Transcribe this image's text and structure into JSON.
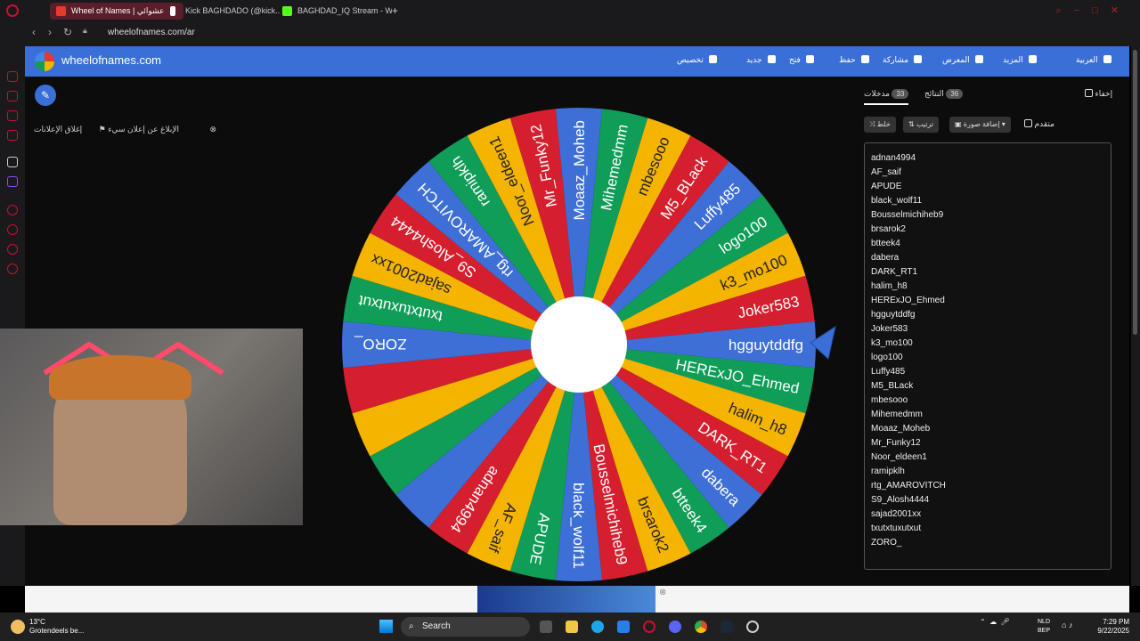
{
  "browser": {
    "tabs": [
      {
        "title": "Wheel of Names | عشوائي",
        "color": "#e63a2e"
      },
      {
        "title": "Kick BAGHDADO (@kick...",
        "color": "#ffffff"
      },
      {
        "title": "BAGHDAD_IQ Stream - W",
        "color": "#53fc18"
      }
    ],
    "url": "wheelofnames.com/ar"
  },
  "site": {
    "name": "wheelofnames.com",
    "menu": [
      "تخصيص",
      "جديد",
      "فتح",
      "حفظ",
      "مشاركة",
      "المعرض",
      "المزيد",
      "العربية"
    ],
    "report_ad": "الإبلاغ عن إعلان سيء",
    "close_ads": "إغلاق الإعلانات"
  },
  "wheel": {
    "entries": [
      "hgguytddfg",
      "HERExJO_Ehmed",
      "halim_h8",
      "DARK_RT1",
      "dabera",
      "btteek4",
      "brsarok2",
      "Bousselmichiheb9",
      "black_wolf11",
      "APUDE",
      "AF_saif",
      "adnan4994",
      "",
      "",
      "",
      "",
      "ZORO_",
      "txutxtuxutxut",
      "sajad2001xx",
      "S9_Alosh4444",
      "rtg_AMAROVITCH",
      "ramipklh",
      "Noor_eldeen1",
      "Mr_Funky12",
      "Moaaz_Moheb",
      "Mihemedmm",
      "mbesooo",
      "M5_BLack",
      "Luffy485",
      "logo100",
      "k3_mo100",
      "Joker583"
    ],
    "colors": [
      "#3d6fd6",
      "#0f9d58",
      "#f4b400",
      "#d51f2e"
    ]
  },
  "panel": {
    "tab_entries": "مدخلات",
    "tab_entries_count": "33",
    "tab_results": "النتائج",
    "tab_results_count": "36",
    "hide": "إخفاء",
    "shuffle": "خلط",
    "sort": "ترتيب",
    "add_image": "إضافة صورة",
    "advanced": "متقدم",
    "entries": [
      "adnan4994",
      "AF_saif",
      "APUDE",
      "black_wolf11",
      "Bousselmichiheb9",
      "brsarok2",
      "btteek4",
      "dabera",
      "DARK_RT1",
      "halim_h8",
      "HERExJO_Ehmed",
      "hgguytddfg",
      "Joker583",
      "k3_mo100",
      "logo100",
      "Luffy485",
      "M5_BLack",
      "mbesooo",
      "Mihemedmm",
      "Moaaz_Moheb",
      "Mr_Funky12",
      "Noor_eldeen1",
      "ramipklh",
      "rtg_AMAROVITCH",
      "S9_Alosh4444",
      "sajad2001xx",
      "txutxtuxutxut",
      "ZORO_"
    ]
  },
  "taskbar": {
    "temp": "13°C",
    "weather": "Grotendeels be...",
    "search": "Search",
    "lang1": "NLD",
    "lang2": "BEP",
    "time": "7:29 PM",
    "date": "9/22/2025"
  }
}
